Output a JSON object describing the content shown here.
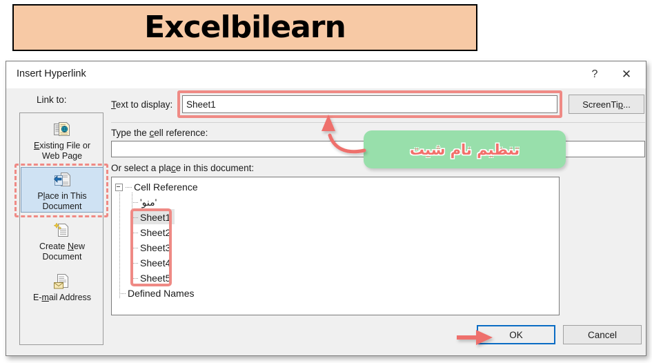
{
  "banner": {
    "text": "Excelbilearn",
    "bg": "#f7c9a5",
    "border": "#000000"
  },
  "dialog": {
    "title": "Insert Hyperlink",
    "help_icon": "?",
    "close_icon": "✕",
    "linkto_label": "Link to:"
  },
  "sidebar": {
    "items": [
      {
        "id": "existing-file",
        "icon": "document-globe-icon",
        "label": "Existing File or\nWeb Page",
        "selected": false
      },
      {
        "id": "place-in-document",
        "icon": "document-arrow-icon",
        "label": "Place in This\nDocument",
        "selected": true
      },
      {
        "id": "create-new-document",
        "icon": "document-sparkle-icon",
        "label": "Create New\nDocument",
        "selected": false
      },
      {
        "id": "email-address",
        "icon": "document-envelope-icon",
        "label": "E-mail Address",
        "selected": false
      }
    ]
  },
  "form": {
    "text_to_display_label": "Text to display:",
    "text_to_display_value": "Sheet1",
    "text_to_display_placeholder": "",
    "screentip_button": "ScreenTip...",
    "cell_reference_label": "Type the cell reference:",
    "cell_reference_value": "",
    "cell_reference_placeholder": "",
    "place_label": "Or select a place in this document:"
  },
  "tree": {
    "nodes": [
      {
        "label": "Cell Reference",
        "level": 0,
        "expander": true,
        "selected": false
      },
      {
        "label": "'منو'",
        "level": 1,
        "expander": false,
        "selected": false
      },
      {
        "label": "Sheet1",
        "level": 1,
        "expander": false,
        "selected": true
      },
      {
        "label": "Sheet2",
        "level": 1,
        "expander": false,
        "selected": false
      },
      {
        "label": "Sheet3",
        "level": 1,
        "expander": false,
        "selected": false
      },
      {
        "label": "Sheet4",
        "level": 1,
        "expander": false,
        "selected": false
      },
      {
        "label": "Sheet5",
        "level": 1,
        "expander": false,
        "selected": false
      },
      {
        "label": "Defined Names",
        "level": 0,
        "expander": false,
        "selected": false
      }
    ]
  },
  "footer": {
    "ok_label": "OK",
    "cancel_label": "Cancel"
  },
  "annotations": {
    "callout_text": "تنظیم نام شیت",
    "callout_bg": "#98dfab",
    "callout_fg": "#f2706b",
    "highlight_color": "#ef8a85",
    "focus_color": "#0a6cc4"
  }
}
